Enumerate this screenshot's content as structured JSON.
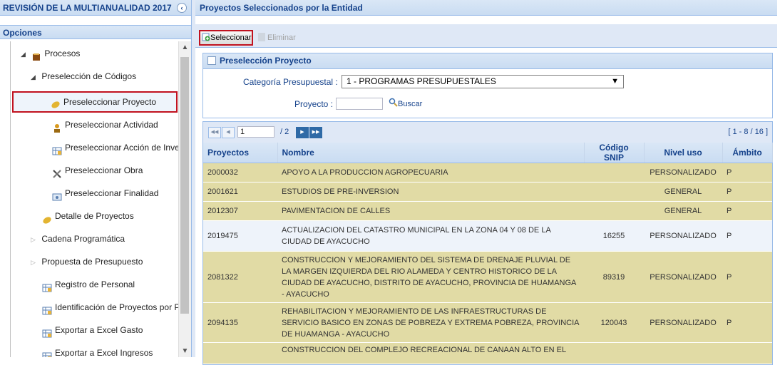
{
  "left": {
    "title": "REVISIÓN DE LA MULTIANUALIDAD 2017",
    "collapse_icon": "‹",
    "opciones": "Opciones",
    "tree": [
      {
        "label": "Procesos",
        "icon": "book-icon"
      },
      {
        "label": "Preselección de Códigos"
      },
      {
        "label": "Preseleccionar Proyecto",
        "icon": "leaf-icon"
      },
      {
        "label": "Preseleccionar Actividad",
        "icon": "person-icon"
      },
      {
        "label": "Preseleccionar Acción de Inversi",
        "icon": "table-icon"
      },
      {
        "label": "Preseleccionar Obra",
        "icon": "tools-icon"
      },
      {
        "label": "Preseleccionar Finalidad",
        "icon": "folder-icon"
      },
      {
        "label": "Detalle de Proyectos",
        "icon": "leaf-icon"
      },
      {
        "label": "Cadena Programática"
      },
      {
        "label": "Propuesta de Presupuesto"
      },
      {
        "label": "Registro de Personal",
        "icon": "table-icon"
      },
      {
        "label": "Identificación de Proyectos por Prod",
        "icon": "table-icon"
      },
      {
        "label": "Exportar a Excel Gasto",
        "icon": "table-icon"
      },
      {
        "label": "Exportar a Excel Ingresos",
        "icon": "table-icon"
      }
    ]
  },
  "right": {
    "title": "Proyectos Seleccionados por la Entidad",
    "toolbar": {
      "seleccionar": "Seleccionar",
      "eliminar": "Eliminar"
    },
    "panel_title": "Preselección Proyecto",
    "form": {
      "categoria_label": "Categoría Presupuestal :",
      "categoria_value": "1 - PROGRAMAS PRESUPUESTALES",
      "proyecto_label": "Proyecto :",
      "proyecto_value": "",
      "buscar": "Buscar"
    },
    "pager": {
      "page": "1",
      "of": "/ 2",
      "range": "[ 1 - 8 / 16 ]"
    },
    "columns": [
      "Proyectos",
      "Nombre",
      "Código SNIP",
      "Nivel uso",
      "Ámbito"
    ],
    "rows": [
      {
        "proyecto": "2000032",
        "nombre": "APOYO A LA PRODUCCION AGROPECUARIA",
        "snip": "",
        "nivel": "PERSONALIZADO",
        "ambito": "P"
      },
      {
        "proyecto": "2001621",
        "nombre": "ESTUDIOS DE PRE-INVERSION",
        "snip": "",
        "nivel": "GENERAL",
        "ambito": "P"
      },
      {
        "proyecto": "2012307",
        "nombre": "PAVIMENTACION DE CALLES",
        "snip": "",
        "nivel": "GENERAL",
        "ambito": "P"
      },
      {
        "proyecto": "2019475",
        "nombre": "ACTUALIZACION DEL CATASTRO MUNICIPAL EN LA ZONA 04 Y 08 DE LA CIUDAD DE AYACUCHO",
        "snip": "16255",
        "nivel": "PERSONALIZADO",
        "ambito": "P"
      },
      {
        "proyecto": "2081322",
        "nombre": "CONSTRUCCION Y MEJORAMIENTO DEL SISTEMA DE DRENAJE PLUVIAL DE LA MARGEN IZQUIERDA DEL RIO ALAMEDA Y CENTRO HISTORICO DE LA CIUDAD DE AYACUCHO, DISTRITO DE AYACUCHO, PROVINCIA DE HUAMANGA - AYACUCHO",
        "snip": "89319",
        "nivel": "PERSONALIZADO",
        "ambito": "P"
      },
      {
        "proyecto": "2094135",
        "nombre": "REHABILITACION Y MEJORAMIENTO DE LAS INFRAESTRUCTURAS DE SERVICIO BASICO EN ZONAS DE POBREZA Y EXTREMA POBREZA, PROVINCIA DE HUAMANGA - AYACUCHO",
        "snip": "120043",
        "nivel": "PERSONALIZADO",
        "ambito": "P"
      },
      {
        "proyecto": "",
        "nombre": "CONSTRUCCION DEL COMPLEJO RECREACIONAL DE CANAAN ALTO EN EL",
        "snip": "",
        "nivel": "",
        "ambito": ""
      }
    ]
  }
}
